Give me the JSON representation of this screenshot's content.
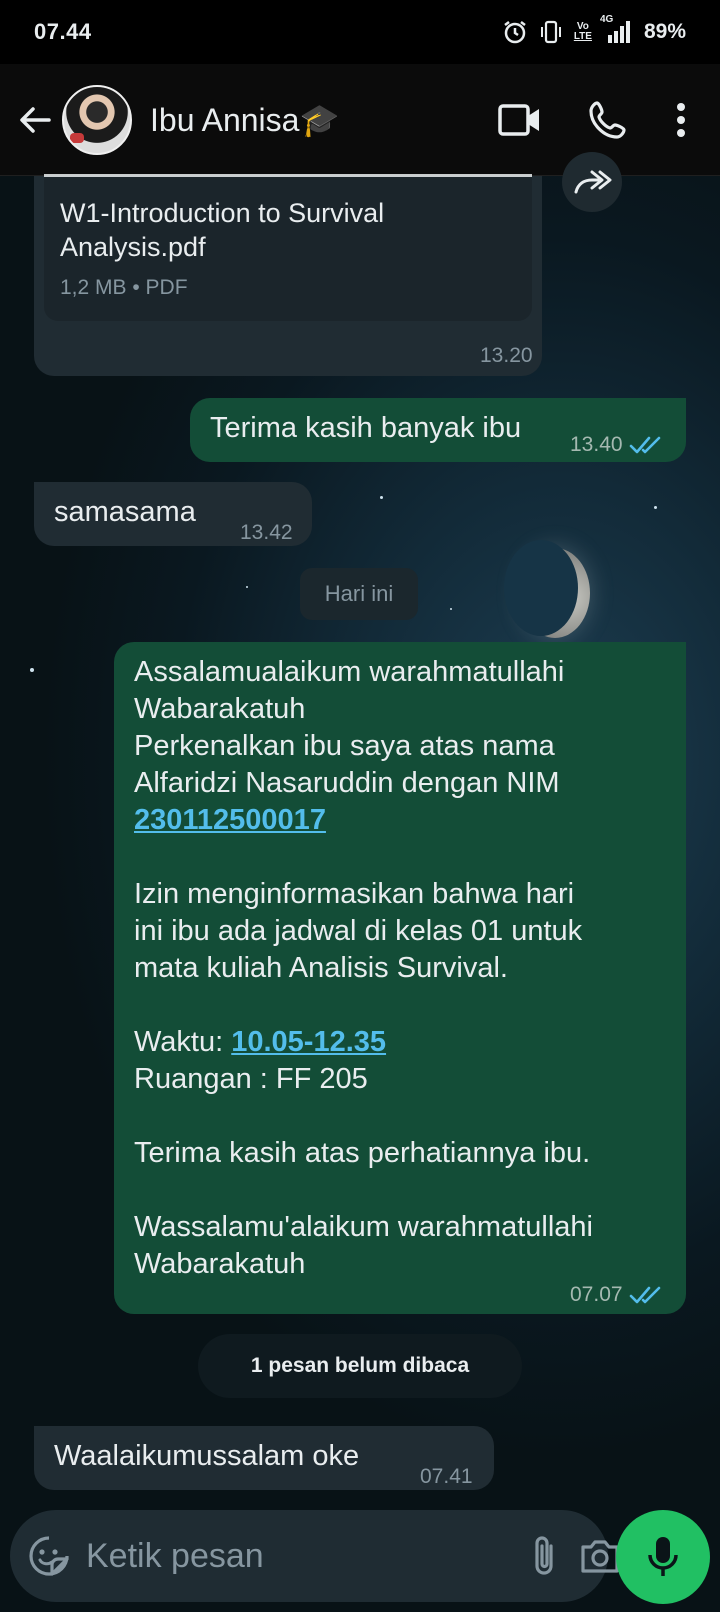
{
  "status_bar": {
    "time": "07.44",
    "network": "4G",
    "volte": [
      "Vo",
      "LTE"
    ],
    "battery": "89%"
  },
  "header": {
    "contact_name": "Ibu Annisa🎓",
    "icons": [
      "back-arrow-icon",
      "video-call-icon",
      "phone-icon",
      "more-vert-icon"
    ]
  },
  "messages": [
    {
      "type": "document",
      "direction": "in",
      "file_name": "W1-Introduction to Survival Analysis.pdf",
      "file_meta": "1,2 MB • PDF",
      "time": "13.20"
    },
    {
      "type": "text",
      "direction": "out",
      "text": "Terima kasih banyak ibu",
      "time": "13.40",
      "status": "read"
    },
    {
      "type": "text",
      "direction": "in",
      "text": "samasama",
      "time": "13.42"
    },
    {
      "type": "day_divider",
      "label": "Hari ini"
    },
    {
      "type": "text",
      "direction": "out",
      "lines": {
        "l1": "Assalamualaikum warahmatullahi",
        "l2": "Wabarakatuh",
        "l3": "Perkenalkan ibu saya atas nama",
        "l4": "Alfaridzi Nasaruddin dengan NIM",
        "nim": "230112500017",
        "l6": "Izin menginformasikan bahwa hari",
        "l7": "ini ibu ada jadwal di kelas 01 untuk",
        "l8": "mata kuliah Analisis Survival.",
        "waktu_label": "Waktu: ",
        "waktu_value": "10.05-12.35",
        "ruangan": "Ruangan : FF 205",
        "thanks": "Terima kasih atas perhatiannya ibu.",
        "closing1": "Wassalamu'alaikum warahmatullahi",
        "closing2": "Wabarakatuh"
      },
      "time": "07.07",
      "status": "read"
    },
    {
      "type": "unread_divider",
      "label": "1 pesan belum dibaca"
    },
    {
      "type": "text",
      "direction": "in",
      "text": "Waalaikumussalam oke",
      "time": "07.41"
    }
  ],
  "composer": {
    "placeholder": "Ketik pesan",
    "icons": [
      "sticker-icon",
      "attach-icon",
      "camera-icon",
      "mic-icon"
    ]
  },
  "colors": {
    "outgoing_bubble": "#134d37",
    "incoming_bubble": "#202c33",
    "read_ticks": "#53bdeb",
    "mic_button": "#21c063"
  }
}
